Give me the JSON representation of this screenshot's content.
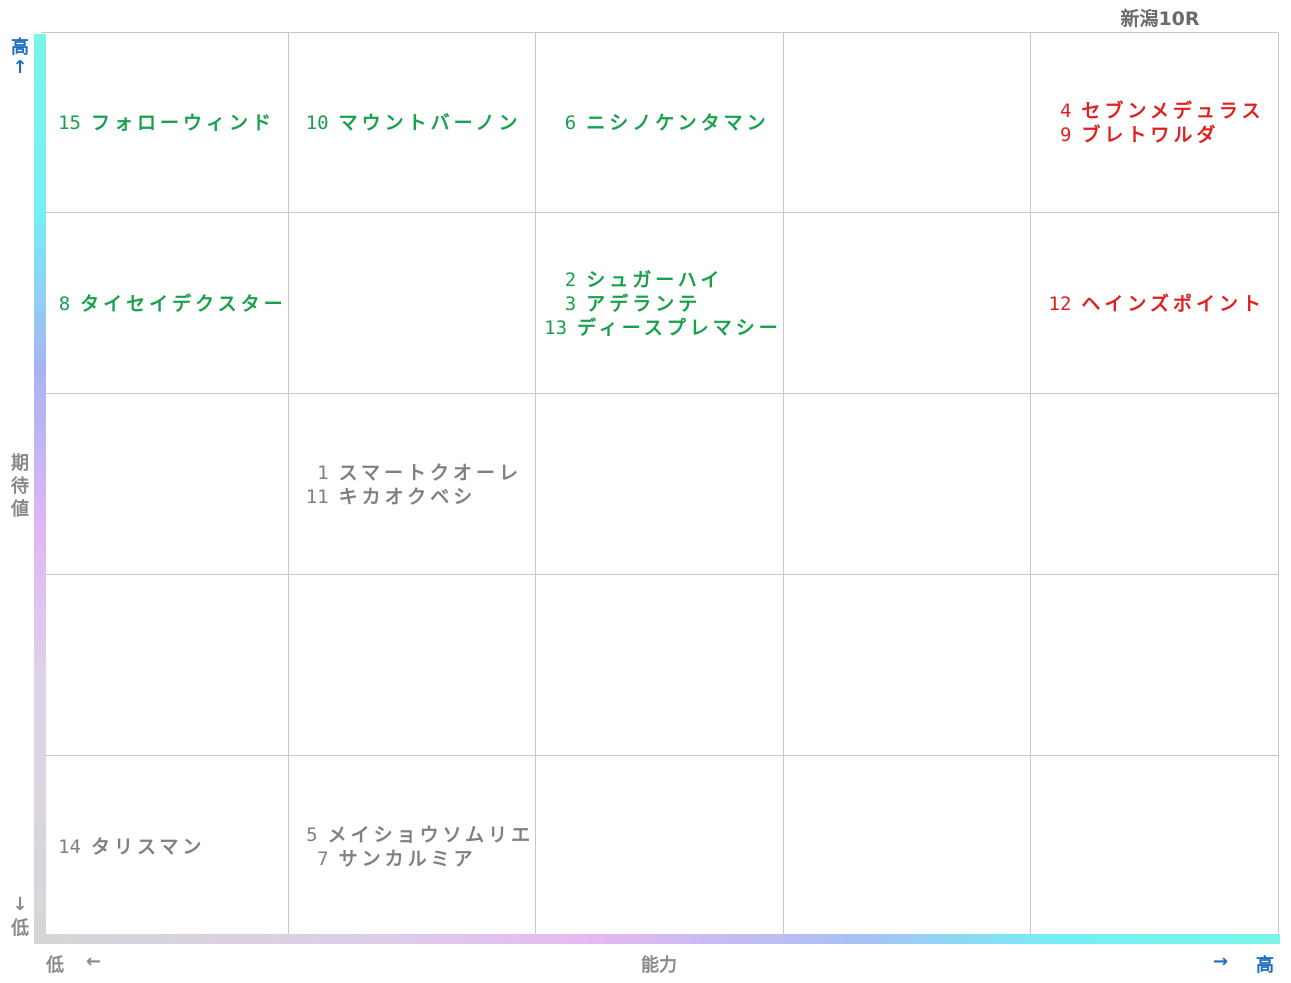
{
  "title": "新潟10R",
  "axes": {
    "y_label": "期待値",
    "y_high": "高",
    "y_low": "低",
    "y_up_arrow": "↑",
    "y_down_arrow": "↓",
    "x_label": "能力",
    "x_low": "低",
    "x_high": "高",
    "x_left_arrow": "←",
    "x_right_arrow": "→"
  },
  "colors": {
    "green": "#18a04c",
    "red": "#e02020",
    "gray": "#808080"
  },
  "chart_data": {
    "type": "table",
    "columns": 5,
    "rows": 5,
    "cells": [
      {
        "row": 0,
        "col": 0,
        "color": "green",
        "entries": [
          {
            "num": "15",
            "name": "フォローウィンド"
          }
        ]
      },
      {
        "row": 0,
        "col": 1,
        "color": "green",
        "entries": [
          {
            "num": "10",
            "name": "マウントバーノン"
          }
        ]
      },
      {
        "row": 0,
        "col": 2,
        "color": "green",
        "entries": [
          {
            "num": "6",
            "name": "ニシノケンタマン"
          }
        ]
      },
      {
        "row": 0,
        "col": 4,
        "color": "red",
        "entries": [
          {
            "num": "4",
            "name": "セブンメデュラス"
          },
          {
            "num": "9",
            "name": "ブレトワルダ"
          }
        ]
      },
      {
        "row": 1,
        "col": 0,
        "color": "green",
        "entries": [
          {
            "num": "8",
            "name": "タイセイデクスター"
          }
        ]
      },
      {
        "row": 1,
        "col": 2,
        "color": "green",
        "entries": [
          {
            "num": "2",
            "name": "シュガーハイ"
          },
          {
            "num": "3",
            "name": "アデランテ"
          },
          {
            "num": "13",
            "name": "ディースプレマシー"
          }
        ]
      },
      {
        "row": 1,
        "col": 4,
        "color": "red",
        "entries": [
          {
            "num": "12",
            "name": "ヘインズポイント"
          }
        ]
      },
      {
        "row": 2,
        "col": 1,
        "color": "gray",
        "entries": [
          {
            "num": "1",
            "name": "スマートクオーレ"
          },
          {
            "num": "11",
            "name": "キカオクベシ"
          }
        ]
      },
      {
        "row": 4,
        "col": 0,
        "color": "gray",
        "entries": [
          {
            "num": "14",
            "name": "タリスマン"
          }
        ]
      },
      {
        "row": 4,
        "col": 1,
        "color": "gray",
        "entries": [
          {
            "num": "5",
            "name": "メイショウソムリエ"
          },
          {
            "num": "7",
            "name": "サンカルミア"
          }
        ]
      }
    ]
  }
}
